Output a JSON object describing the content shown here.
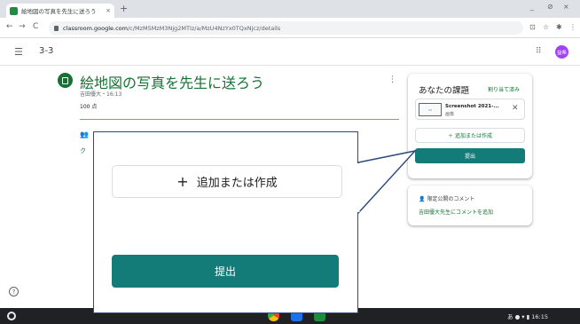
{
  "browser": {
    "tab_title": "絵地図の写真を先生に送ろう",
    "tab_close": "×",
    "new_tab": "+",
    "url_host": "classroom.google.com",
    "url_path": "/c/MzM5MzM3Njg2MTIz/a/MzU4NzYx0TQxNjcz/details",
    "window_controls": [
      "_",
      "⊘",
      "×"
    ],
    "nav_icons": [
      "←",
      "→",
      "C"
    ]
  },
  "header": {
    "class_name": "3-3",
    "avatar_initials": "益希"
  },
  "assignment": {
    "title": "絵地図の写真を先生に送ろう",
    "meta": "吉田優大・16:13",
    "points": "100 点",
    "partial_link": "ク"
  },
  "your_work": {
    "title": "あなたの課題",
    "status": "割り当て済み",
    "attachment_name": "Screenshot 2021-...",
    "attachment_type": "画像",
    "add_label": "＋ 追加または作成",
    "submit_label": "提出"
  },
  "private_comments": {
    "title": "限定公開のコメント",
    "link": "吉田優大先生にコメントを追加"
  },
  "callout": {
    "add_label": "追加または作成",
    "add_plus": "+",
    "submit_label": "提出"
  },
  "system_tray": {
    "time": "16:15"
  },
  "colors": {
    "classroom_green": "#137333",
    "submit_teal": "#137b78",
    "callout_border": "#2f4a7c"
  }
}
